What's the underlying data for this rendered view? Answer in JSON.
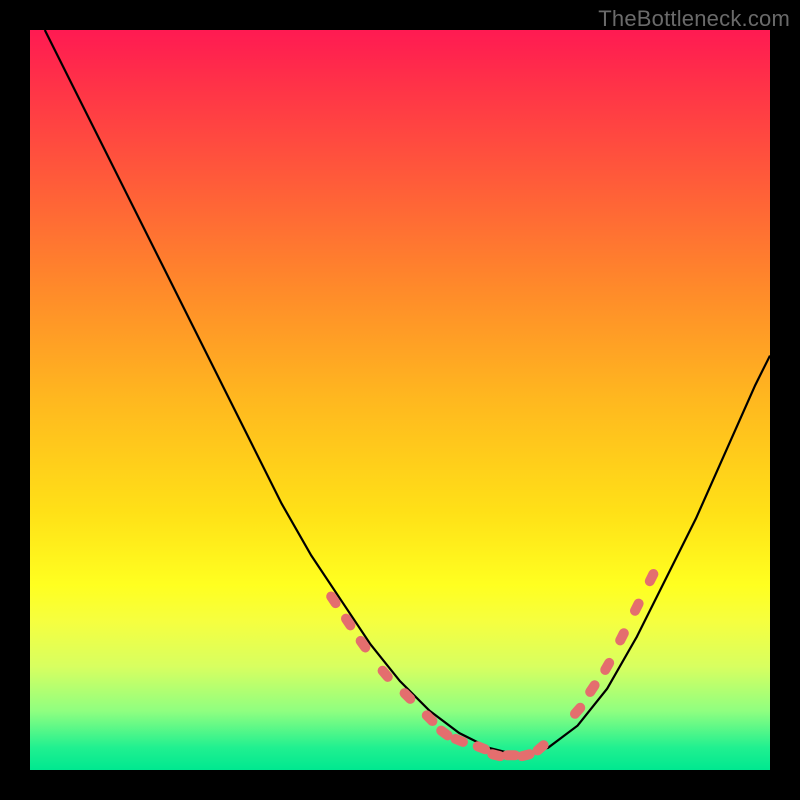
{
  "watermark": "TheBottleneck.com",
  "chart_data": {
    "type": "line",
    "title": "",
    "xlabel": "",
    "ylabel": "",
    "xlim": [
      0,
      100
    ],
    "ylim": [
      0,
      100
    ],
    "series": [
      {
        "name": "curve",
        "color": "#000000",
        "x": [
          2,
          6,
          10,
          14,
          18,
          22,
          26,
          30,
          34,
          38,
          42,
          46,
          50,
          54,
          58,
          62,
          66,
          70,
          74,
          78,
          82,
          86,
          90,
          94,
          98,
          100
        ],
        "y": [
          100,
          92,
          84,
          76,
          68,
          60,
          52,
          44,
          36,
          29,
          23,
          17,
          12,
          8,
          5,
          3,
          2,
          3,
          6,
          11,
          18,
          26,
          34,
          43,
          52,
          56
        ]
      }
    ],
    "markers": {
      "name": "highlighted-points",
      "color": "#e46e6e",
      "x": [
        41,
        43,
        45,
        48,
        51,
        54,
        56,
        58,
        61,
        63,
        65,
        67,
        69,
        74,
        76,
        78,
        80,
        82,
        84
      ],
      "y": [
        23,
        20,
        17,
        13,
        10,
        7,
        5,
        4,
        3,
        2,
        2,
        2,
        3,
        8,
        11,
        14,
        18,
        22,
        26
      ]
    }
  }
}
